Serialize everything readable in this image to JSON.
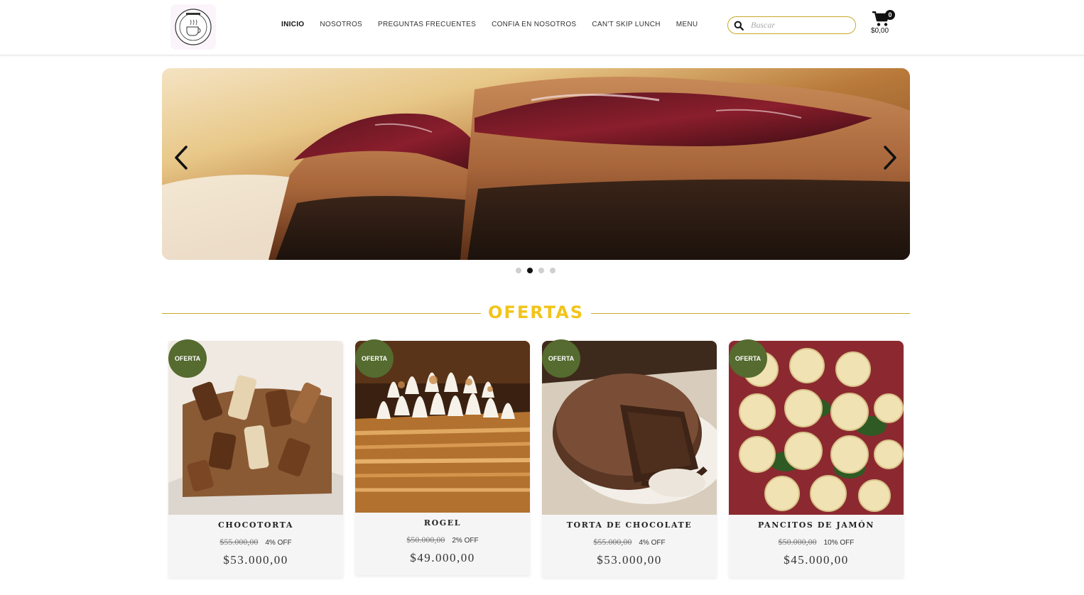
{
  "header": {
    "logo_alt": "Pan de Azúcar",
    "nav": [
      {
        "label": "INICIO",
        "active": true
      },
      {
        "label": "NOSOTROS",
        "active": false
      },
      {
        "label": "PREGUNTAS FRECUENTES",
        "active": false
      },
      {
        "label": "CONFIA EN NOSOTROS",
        "active": false
      },
      {
        "label": "CAN'T SKIP LUNCH",
        "active": false
      },
      {
        "label": "MENU",
        "active": false
      }
    ],
    "search": {
      "placeholder": "Buscar",
      "value": ""
    },
    "cart": {
      "count": "0",
      "total": "$0,00"
    }
  },
  "slider": {
    "active_index": 1,
    "slides_count": 4
  },
  "ofertas": {
    "title": "OFERTAS",
    "products": [
      {
        "badge": "OFERTA",
        "name": "CHOCOTORTA",
        "old_price": "$55.000,00",
        "discount": "4% OFF",
        "price": "$53.000,00"
      },
      {
        "badge": "OFERTA",
        "name": "ROGEL",
        "old_price": "$50.000,00",
        "discount": "2% OFF",
        "price": "$49.000,00"
      },
      {
        "badge": "OFERTA",
        "name": "TORTA DE CHOCOLATE",
        "old_price": "$55.000,00",
        "discount": "4% OFF",
        "price": "$53.000,00"
      },
      {
        "badge": "OFERTA",
        "name": "PANCITOS DE JAMÓN",
        "old_price": "$50.000,00",
        "discount": "10% OFF",
        "price": "$45.000,00"
      }
    ]
  },
  "colors": {
    "accent_gold": "#f2c41a",
    "search_border": "#c8a828",
    "badge_green": "#556b2f"
  }
}
